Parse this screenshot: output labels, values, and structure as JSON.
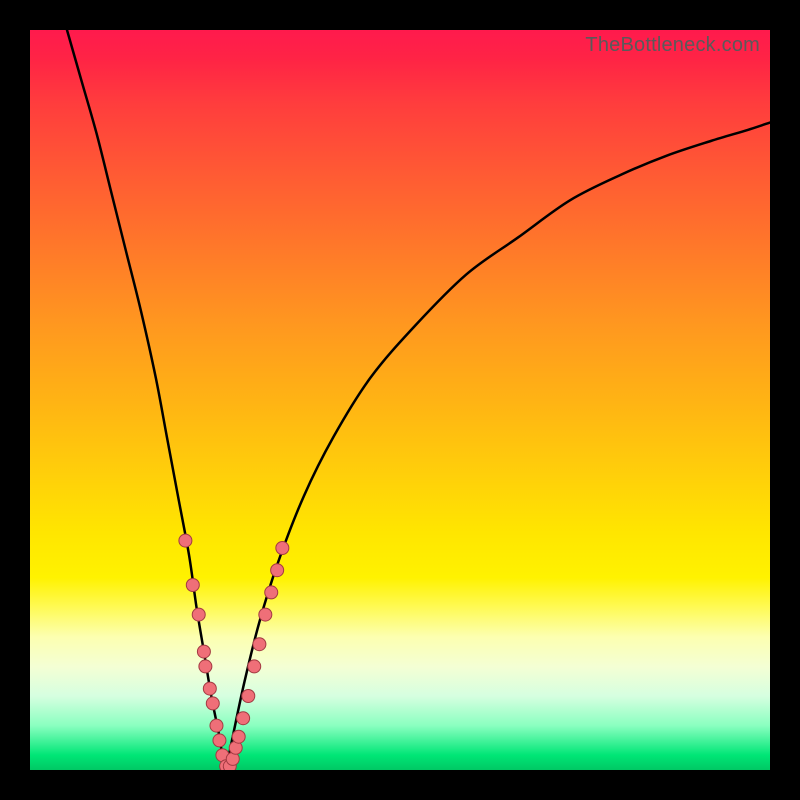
{
  "watermark": "TheBottleneck.com",
  "colors": {
    "frame": "#000000",
    "curve_stroke": "#000000",
    "dot_fill": "#ef6f78",
    "dot_stroke": "#a33a42"
  },
  "chart_data": {
    "type": "line",
    "title": "",
    "xlabel": "",
    "ylabel": "",
    "xlim": [
      0,
      100
    ],
    "ylim": [
      0,
      100
    ],
    "grid": false,
    "legend": false,
    "series": [
      {
        "name": "left-branch",
        "x": [
          5,
          7,
          9,
          11,
          13,
          15,
          17,
          18.5,
          20,
          21.5,
          22.5,
          23.5,
          24.5,
          25.5,
          26,
          26.5
        ],
        "y": [
          100,
          93,
          86,
          78,
          70,
          62,
          53,
          45,
          37,
          29,
          22,
          16,
          10,
          5,
          2,
          0
        ]
      },
      {
        "name": "right-branch",
        "x": [
          26.5,
          27.5,
          29,
          31,
          33.5,
          37,
          41,
          46,
          52,
          59,
          66,
          73,
          80,
          86,
          92,
          97,
          100
        ],
        "y": [
          0,
          5,
          12,
          20,
          28,
          37,
          45,
          53,
          60,
          67,
          72,
          77,
          80.5,
          83,
          85,
          86.5,
          87.5
        ]
      }
    ],
    "scatter_overlay": {
      "name": "dots",
      "points": [
        {
          "x": 21.0,
          "y": 31
        },
        {
          "x": 22.0,
          "y": 25
        },
        {
          "x": 22.8,
          "y": 21
        },
        {
          "x": 23.5,
          "y": 16
        },
        {
          "x": 23.7,
          "y": 14
        },
        {
          "x": 24.3,
          "y": 11
        },
        {
          "x": 24.7,
          "y": 9
        },
        {
          "x": 25.2,
          "y": 6
        },
        {
          "x": 25.6,
          "y": 4
        },
        {
          "x": 26.0,
          "y": 2
        },
        {
          "x": 26.5,
          "y": 0.5
        },
        {
          "x": 27.0,
          "y": 0.5
        },
        {
          "x": 27.4,
          "y": 1.5
        },
        {
          "x": 27.8,
          "y": 3
        },
        {
          "x": 28.2,
          "y": 4.5
        },
        {
          "x": 28.8,
          "y": 7
        },
        {
          "x": 29.5,
          "y": 10
        },
        {
          "x": 30.3,
          "y": 14
        },
        {
          "x": 31.0,
          "y": 17
        },
        {
          "x": 31.8,
          "y": 21
        },
        {
          "x": 32.6,
          "y": 24
        },
        {
          "x": 33.4,
          "y": 27
        },
        {
          "x": 34.1,
          "y": 30
        }
      ]
    }
  }
}
